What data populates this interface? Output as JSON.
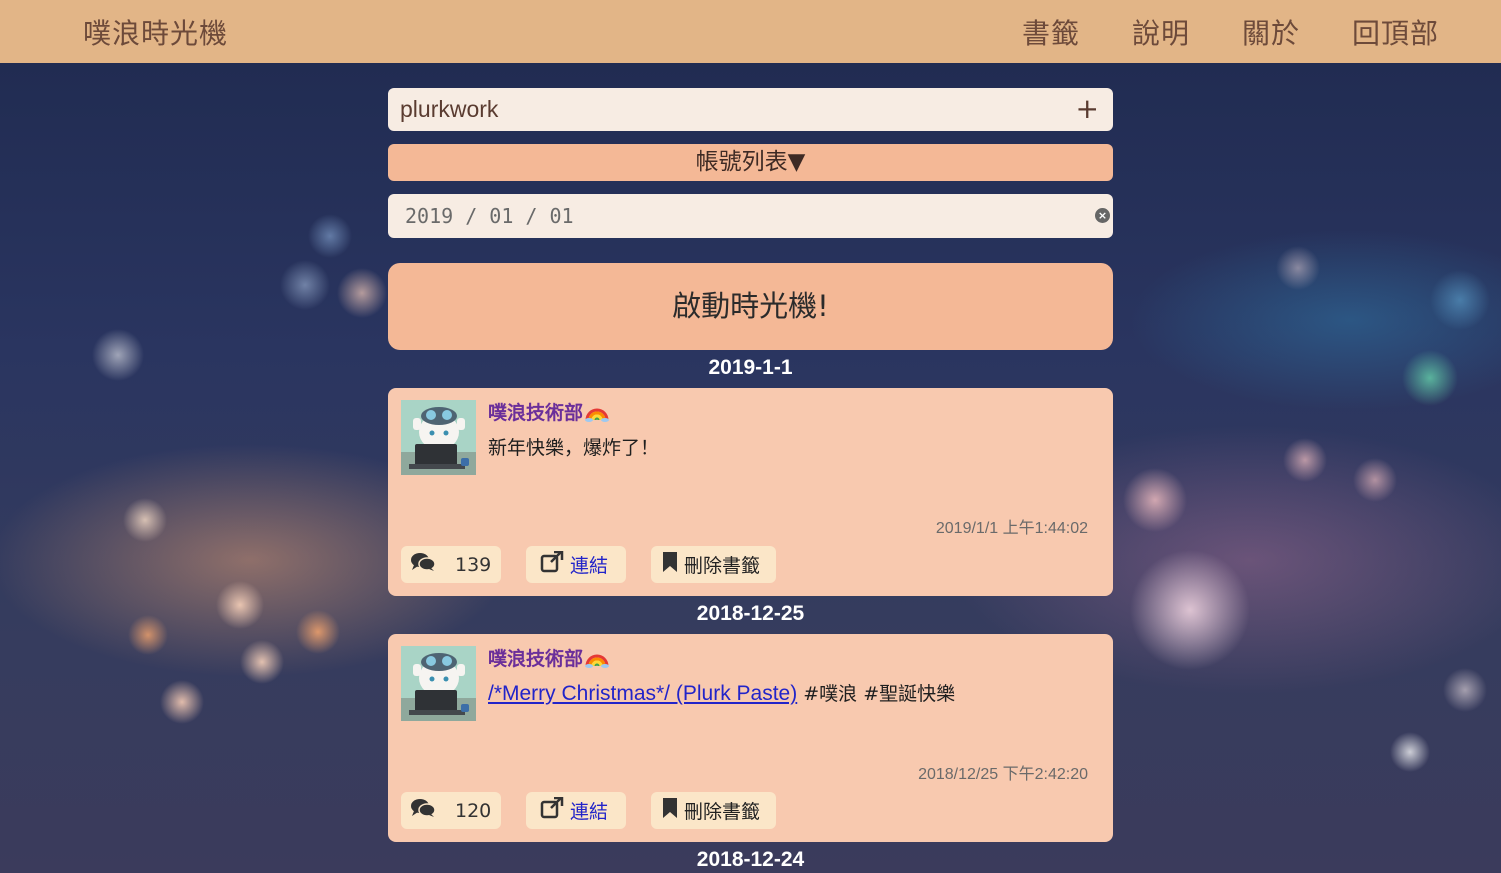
{
  "header": {
    "brand": "噗浪時光機",
    "nav": [
      "書籤",
      "說明",
      "關於",
      "回頂部"
    ]
  },
  "form": {
    "account_value": "plurkwork",
    "add_icon": "plus-icon",
    "account_list_label": "帳號列表▼",
    "date_value": "2019 / 01 / 01",
    "launch_label": "啟動時光機!"
  },
  "posts": [
    {
      "date_heading": "2019-1-1",
      "author": "噗浪技術部",
      "content_text": "新年快樂，爆炸了！",
      "timestamp": "2019/1/1 上午1:44:02",
      "response_count": "139",
      "link_label": "連結",
      "bookmark_label": "刪除書籤"
    },
    {
      "date_heading": "2018-12-25",
      "author": "噗浪技術部",
      "content_link": "/*Merry Christmas*/ (Plurk Paste)",
      "content_text": " #噗浪 #聖誕快樂",
      "timestamp": "2018/12/25 下午2:42:20",
      "response_count": "120",
      "link_label": "連結",
      "bookmark_label": "刪除書籤"
    }
  ],
  "next_date_heading": "2018-12-24",
  "colors": {
    "header_bg": "#e2b587",
    "button_bg": "#f4b896",
    "card_bg": "#f8c9af",
    "pill_bg": "#fbe6c8",
    "author_color": "#6b2f9a",
    "link_color": "#2224c9"
  }
}
